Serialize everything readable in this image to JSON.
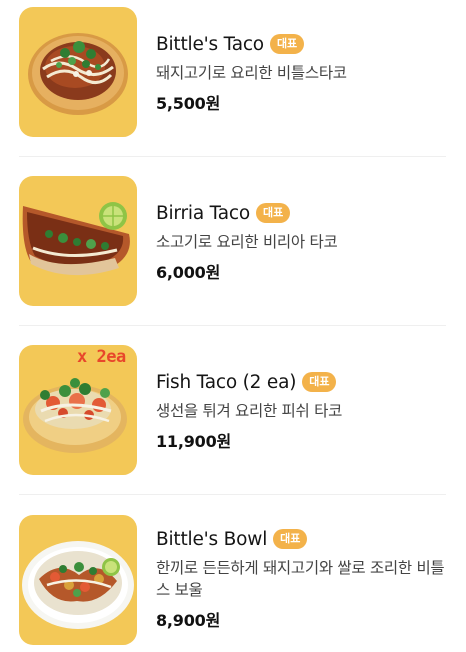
{
  "menu": {
    "items": [
      {
        "name": "Bittle's Taco",
        "badge": "대표",
        "description": "돼지고기로 요리한 비틀스타코",
        "price": "5,500원",
        "image_icon": "pork-taco-image"
      },
      {
        "name": "Birria Taco",
        "badge": "대표",
        "description": "소고기로 요리한 비리아 타코",
        "price": "6,000원",
        "image_icon": "birria-taco-image"
      },
      {
        "name": "Fish Taco (2 ea)",
        "badge": "대표",
        "description": "생선을 튀겨 요리한 피쉬 타코",
        "price": "11,900원",
        "image_icon": "fish-taco-image",
        "image_overlay_text": "x 2ea"
      },
      {
        "name": "Bittle's Bowl",
        "badge": "대표",
        "description": "한끼로 든든하게 돼지고기와 쌀로 조리한 비틀스 보울",
        "price": "8,900원",
        "image_icon": "rice-bowl-image"
      }
    ]
  },
  "colors": {
    "thumb_background": "#f3c857",
    "badge_background": "#f3b24a",
    "overlay_text": "#e8472b",
    "divider": "#efefef"
  }
}
